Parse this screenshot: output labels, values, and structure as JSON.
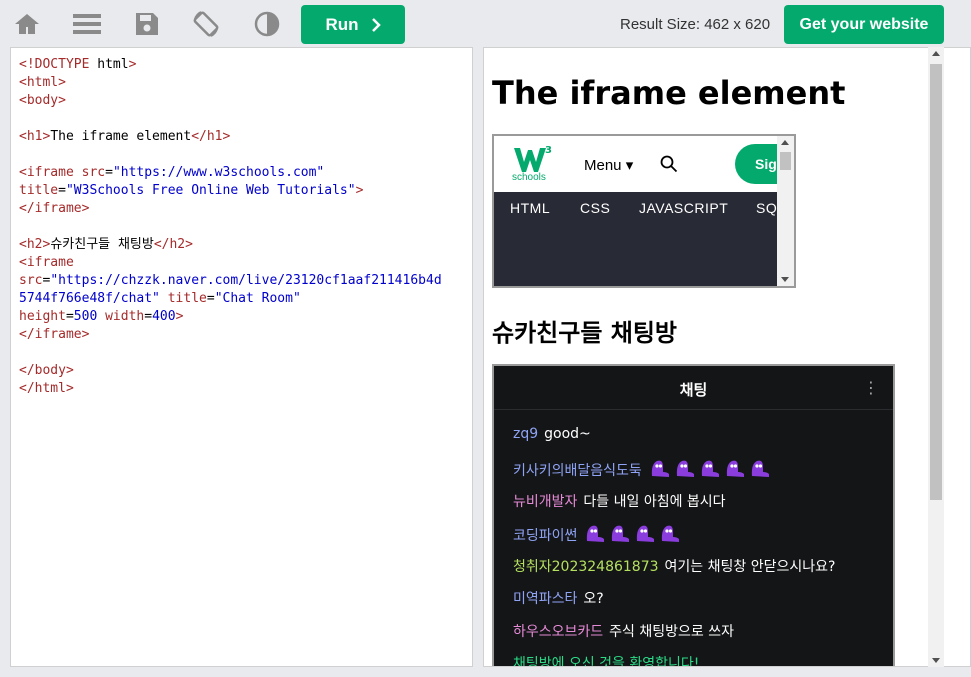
{
  "toolbar": {
    "run_label": "Run",
    "result_size": "Result Size: 462 x 620",
    "get_website_label": "Get your website",
    "icons": [
      "home-icon",
      "menu-icon",
      "save-icon",
      "rotate-icon",
      "contrast-icon"
    ],
    "accent_color": "#04aa6d"
  },
  "code": {
    "lines": [
      "<!DOCTYPE html>",
      "<html>",
      "<body>",
      "",
      "<h1>The iframe element</h1>",
      "",
      "<iframe src=\"https://www.w3schools.com\"",
      "title=\"W3Schools Free Online Web Tutorials\">",
      "</iframe>",
      "",
      "<h2>슈카친구들 채팅방</h2>",
      "<iframe",
      "src=\"https://chzzk.naver.com/live/23120cf1aaf211416b4d",
      "5744f766e48f/chat\" title=\"Chat Room\"",
      "height=500 width=400>",
      "</iframe>",
      "",
      "</body>",
      "</html>"
    ]
  },
  "result": {
    "h1": "The iframe element",
    "h2": "슈카친구들 채팅방",
    "w3": {
      "menu": "Menu",
      "sign": "Sign",
      "schools": "schools",
      "nav": [
        "HTML",
        "CSS",
        "JAVASCRIPT",
        "SQL"
      ]
    },
    "chat": {
      "title": "채팅",
      "messages": [
        {
          "user": "zq9",
          "text": "good~",
          "color": "#8fa4f5",
          "emotes": 0
        },
        {
          "user": "키사키의배달음식도둑",
          "text": "",
          "color": "#8fa4f5",
          "emotes": 5
        },
        {
          "user": "뉴비개발자",
          "text": "다들 내일 아침에 봅시다",
          "color": "#e58ad6",
          "emotes": 0
        },
        {
          "user": "코딩파이썬",
          "text": "",
          "color": "#8fa4f5",
          "emotes": 4
        },
        {
          "user": "청취자202324861873",
          "text": "여기는 채팅창 안닫으시나요?",
          "color": "#b5e05f",
          "emotes": 0
        },
        {
          "user": "미역파스타",
          "text": "오?",
          "color": "#8fa4f5",
          "emotes": 0
        },
        {
          "user": "하우스오브카드",
          "text": "주식 채팅방으로 쓰자",
          "color": "#e58ad6",
          "emotes": 0
        },
        {
          "user": "채팅방에 오신 것을 환영합니다!",
          "text": "",
          "color": "#2bdb86",
          "emotes": 0
        }
      ]
    }
  }
}
